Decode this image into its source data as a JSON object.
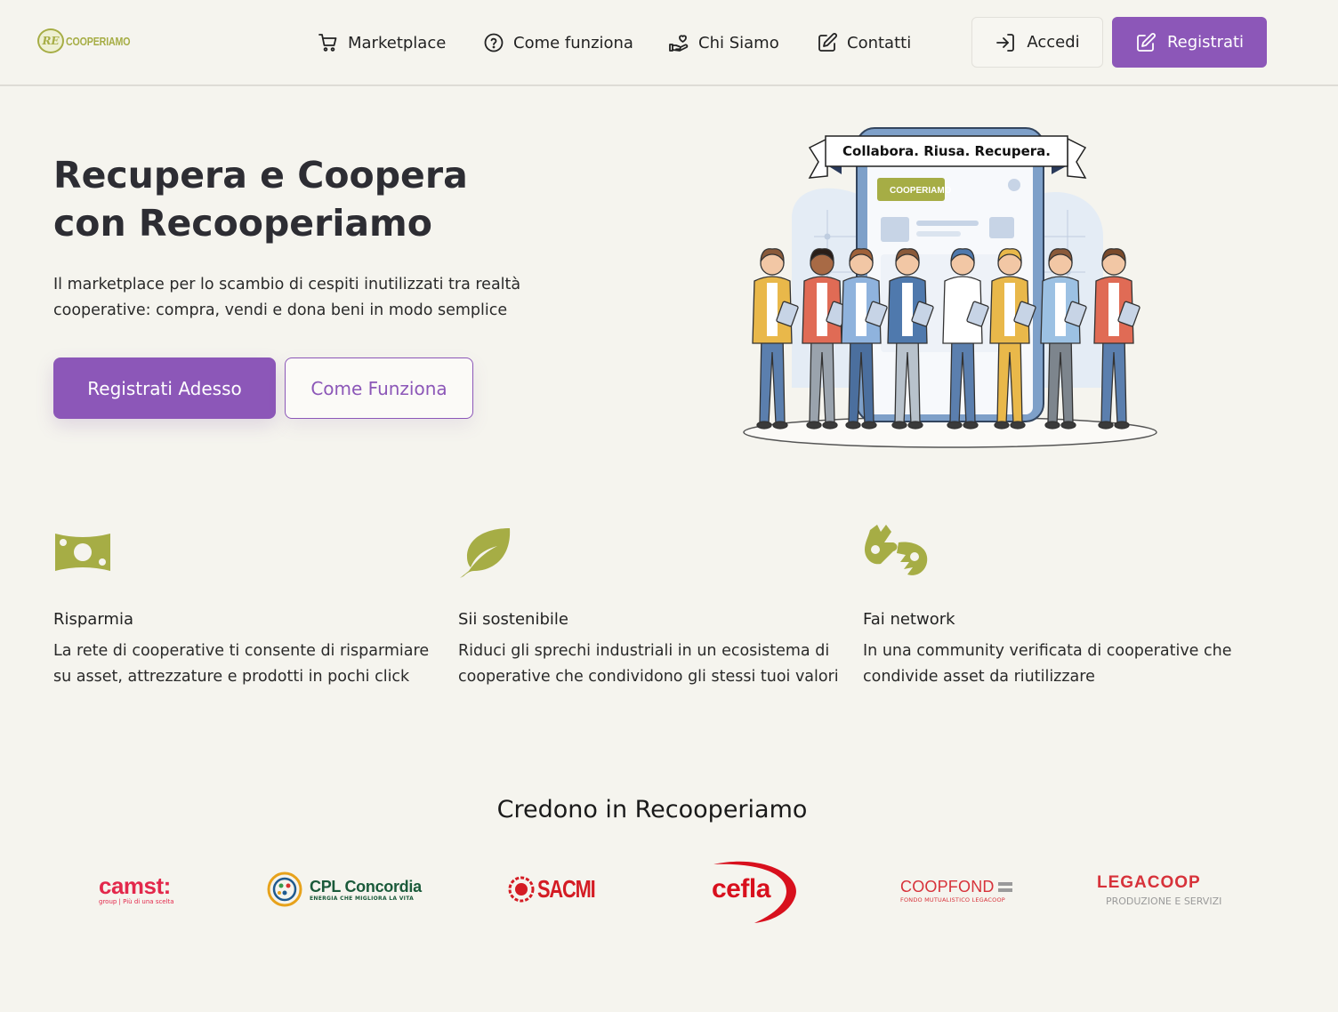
{
  "header": {
    "logo_badge": "RE",
    "logo_text": "COOPERIAMO",
    "nav": [
      {
        "label": "Marketplace",
        "icon": "cart-icon"
      },
      {
        "label": "Come funziona",
        "icon": "question-circle-icon"
      },
      {
        "label": "Chi Siamo",
        "icon": "hand-heart-icon"
      },
      {
        "label": "Contatti",
        "icon": "edit-square-icon"
      }
    ],
    "login_label": "Accedi",
    "register_label": "Registrati"
  },
  "hero": {
    "title": "Recupera e Coopera con Recooperiamo",
    "subtitle": "Il marketplace per lo scambio di cespiti inutilizzati tra realtà cooperative: compra, vendi e dona beni in modo semplice",
    "cta_primary": "Registrati Adesso",
    "cta_secondary": "Come Funziona",
    "illustration_banner": "Collabora. Riusa. Recupera.",
    "illustration_logo": "COOPERIAMO"
  },
  "features": [
    {
      "icon": "money-bill-icon",
      "title": "Risparmia",
      "desc": "La rete di cooperative ti consente di risparmiare su asset, attrezzature e prodotti in pochi click"
    },
    {
      "icon": "leaf-icon",
      "title": "Sii sostenibile",
      "desc": "Riduci gli sprechi industriali in un ecosistema di cooperative che condividono gli stessi tuoi valori"
    },
    {
      "icon": "sign-language-icon",
      "title": "Fai network",
      "desc": "In una community verificata di cooperative che condivide asset da riutilizzare"
    }
  ],
  "partners": {
    "title": "Credono in Recooperiamo",
    "logos": [
      {
        "name": "camst",
        "main": "camst:",
        "tagline": "group | Più di una scelta"
      },
      {
        "name": "cpl",
        "main": "CPL Concordia",
        "tagline": "ENERGIA CHE MIGLIORA LA VITA"
      },
      {
        "name": "sacmi",
        "main": "SACMI"
      },
      {
        "name": "cefla",
        "main": "cefla"
      },
      {
        "name": "coopfond",
        "main": "COOPFOND",
        "tagline": "FONDO MUTUALISTICO LEGACOOP"
      },
      {
        "name": "legacoop",
        "main": "LEGACOOP",
        "tagline": "PRODUZIONE E SERVIZI"
      }
    ]
  },
  "colors": {
    "accent": "#8c57b8",
    "olive": "#a6ad45",
    "background": "#f5f4ee"
  }
}
